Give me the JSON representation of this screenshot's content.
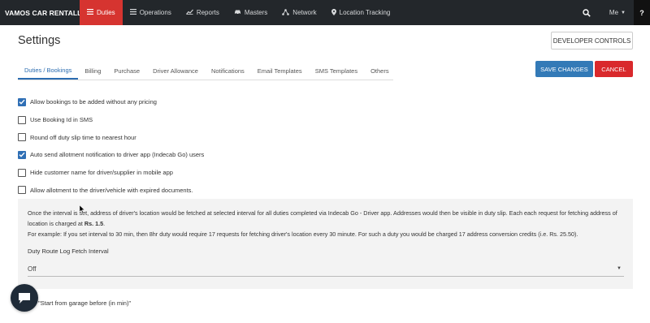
{
  "nav": {
    "brand": "VAMOS CAR RENTALL",
    "items": [
      {
        "label": "Duties",
        "icon": "duties-menu-icon",
        "active": true
      },
      {
        "label": "Operations",
        "icon": "operations-list-icon",
        "active": false
      },
      {
        "label": "Reports",
        "icon": "reports-chart-icon",
        "active": false
      },
      {
        "label": "Masters",
        "icon": "masters-car-icon",
        "active": false
      },
      {
        "label": "Network",
        "icon": "network-icon",
        "active": false
      },
      {
        "label": "Location Tracking",
        "icon": "location-pin-icon",
        "active": false
      }
    ],
    "user": "Me",
    "help": "?"
  },
  "page": {
    "title": "Settings",
    "developer_controls": "DEVELOPER CONTROLS",
    "save_changes": "SAVE CHANGES",
    "cancel": "CANCEL"
  },
  "tabs": [
    {
      "label": "Duties / Bookings",
      "active": true
    },
    {
      "label": "Billing",
      "active": false
    },
    {
      "label": "Purchase",
      "active": false
    },
    {
      "label": "Driver Allowance",
      "active": false
    },
    {
      "label": "Notifications",
      "active": false
    },
    {
      "label": "Email Templates",
      "active": false
    },
    {
      "label": "SMS Templates",
      "active": false
    },
    {
      "label": "Others",
      "active": false
    }
  ],
  "options": [
    {
      "label": "Allow bookings to be added without any pricing",
      "checked": true
    },
    {
      "label": "Use Booking Id in SMS",
      "checked": false
    },
    {
      "label": "Round off duty slip time to nearest hour",
      "checked": false
    },
    {
      "label": "Auto send allotment notification to driver app (Indecab Go) users",
      "checked": true
    },
    {
      "label": "Hide customer name for driver/supplier in mobile app",
      "checked": false
    },
    {
      "label": "Allow allotment to the driver/vehicle with expired documents.",
      "checked": false
    }
  ],
  "route_log": {
    "description_prefix": "Once the interval is set, address of driver's location would be fetched at selected interval for all duties completed via Indecab Go - Driver app. Addresses would then be visible in duty slip. Each each request for fetching address of location is charged at ",
    "price": "Rs. 1.5",
    "description_suffix": ".",
    "example": "For example: If you set interval to 30 min, then 8hr duty would require 17 requests for fetching driver's location every 30 minute. For such a duty you would be charged 17 address conversion credits (i.e. Rs. 25.50).",
    "field_label": "Duty Route Log Fetch Interval",
    "selected": "Off"
  },
  "garage": {
    "label": "\"Start from garage before (in min)\""
  },
  "colors": {
    "nav_bg": "#23272b",
    "active_red": "#d63430",
    "primary_blue": "#337ab7",
    "cancel_red": "#d9292c",
    "checkbox_blue": "#2f6fb5"
  }
}
